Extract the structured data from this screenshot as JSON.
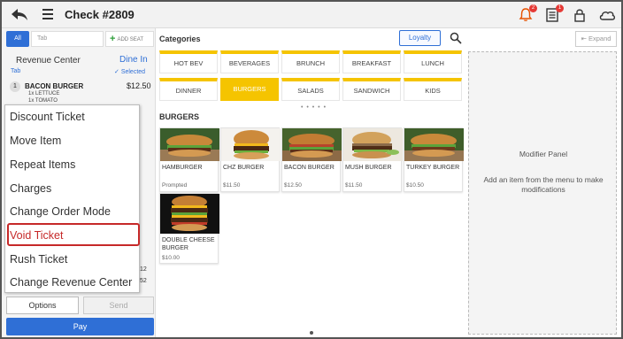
{
  "header": {
    "title": "Check #2809",
    "notification_badge": "2",
    "orders_badge": "1"
  },
  "left_panel": {
    "tabs": {
      "all_label": "All",
      "tab_placeholder": "Tab",
      "add_seat_label": "ADD SEAT"
    },
    "revenue_center": "Revenue Center",
    "order_mode": "Dine In",
    "tab_label": "Tab",
    "selected_label": "Selected",
    "order_item": {
      "number": "1",
      "name": "BACON BURGER",
      "price": "$12.50",
      "modifiers": [
        "1x  LETTUCE",
        "1x  TOMATO"
      ]
    },
    "partial_amounts": [
      "12",
      "52"
    ],
    "buttons": {
      "options": "Options",
      "send": "Send",
      "pay": "Pay"
    }
  },
  "context_menu": {
    "items": [
      "Discount Ticket",
      "Move Item",
      "Repeat Items",
      "Charges",
      "Change Order Mode",
      "Void Ticket",
      "Rush Ticket",
      "Change Revenue Center"
    ],
    "highlighted": "Void Ticket",
    "highlight_color": "#c62828"
  },
  "categories": {
    "title": "Categories",
    "loyalty_label": "Loyalty",
    "items": [
      "HOT BEV",
      "BEVERAGES",
      "BRUNCH",
      "BREAKFAST",
      "LUNCH",
      "DINNER",
      "BURGERS",
      "SALADS",
      "SANDWICH",
      "KIDS"
    ],
    "active": "BURGERS",
    "accent_color": "#f5c400",
    "pager": "• • • • •"
  },
  "menu_section": {
    "title": "BURGERS",
    "items": [
      {
        "name": "HAMBURGER",
        "price": "Prompted"
      },
      {
        "name": "CHZ BURGER",
        "price": "$11.50"
      },
      {
        "name": "BACON BURGER",
        "price": "$12.50"
      },
      {
        "name": "MUSH BURGER",
        "price": "$11.50"
      },
      {
        "name": "TURKEY BURGER",
        "price": "$10.50"
      },
      {
        "name": "DOUBLE CHEESE BURGER",
        "price": "$10.00"
      }
    ]
  },
  "modifier_panel": {
    "expand_label": "Expand",
    "title": "Modifier Panel",
    "hint": "Add an item from the menu to make modifications"
  },
  "colors": {
    "primary": "#2f6fd6"
  }
}
